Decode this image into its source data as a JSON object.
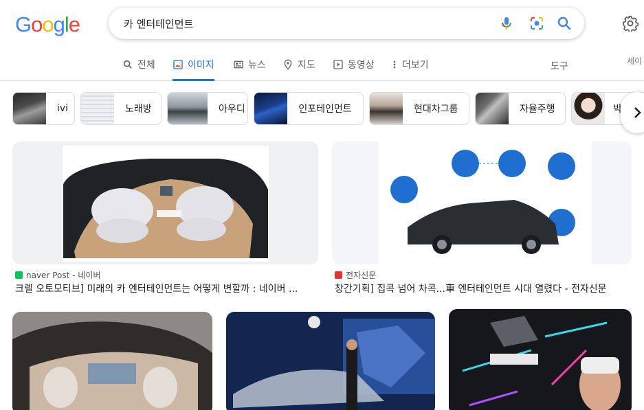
{
  "logo": {
    "text_letters": [
      "G",
      "o",
      "o",
      "g",
      "l",
      "e"
    ],
    "colors": [
      "#4285F4",
      "#EA4335",
      "#FBBC05",
      "#4285F4",
      "#34A853",
      "#EA4335"
    ]
  },
  "search": {
    "query": "카 엔터테인먼트",
    "icons": [
      "mic-icon",
      "camera-lens-icon",
      "search-icon"
    ]
  },
  "settings_icon": "gear-icon",
  "tabs": [
    {
      "label": "전체",
      "icon": "search-icon"
    },
    {
      "label": "이미지",
      "icon": "image-icon",
      "active": true
    },
    {
      "label": "뉴스",
      "icon": "news-icon"
    },
    {
      "label": "지도",
      "icon": "map-pin-icon"
    },
    {
      "label": "동영상",
      "icon": "play-icon"
    },
    {
      "label": "더보기",
      "icon": "more-vert-icon"
    }
  ],
  "tools_label": "도구",
  "safe_search_label": "세이",
  "chips": [
    {
      "label": "ivi"
    },
    {
      "label": "노래방"
    },
    {
      "label": "아우디"
    },
    {
      "label": "인포테인먼트"
    },
    {
      "label": "현대차그룹"
    },
    {
      "label": "자율주행"
    },
    {
      "label": "박"
    }
  ],
  "results": [
    {
      "source": "naver Post - 네이버",
      "title": "크렐 오토모티브] 미래의 카 엔터테인먼트는 어떻게 변할까 : 네이버 ...",
      "favicon_color": "#03C75A"
    },
    {
      "source": "전자신문",
      "title": "창간기획] 집콕 넘어 차콕...車 엔터테인먼트 시대 열렸다 - 전자신문",
      "favicon_color": "#E8322D"
    }
  ],
  "accent_color": "#1a73e8"
}
